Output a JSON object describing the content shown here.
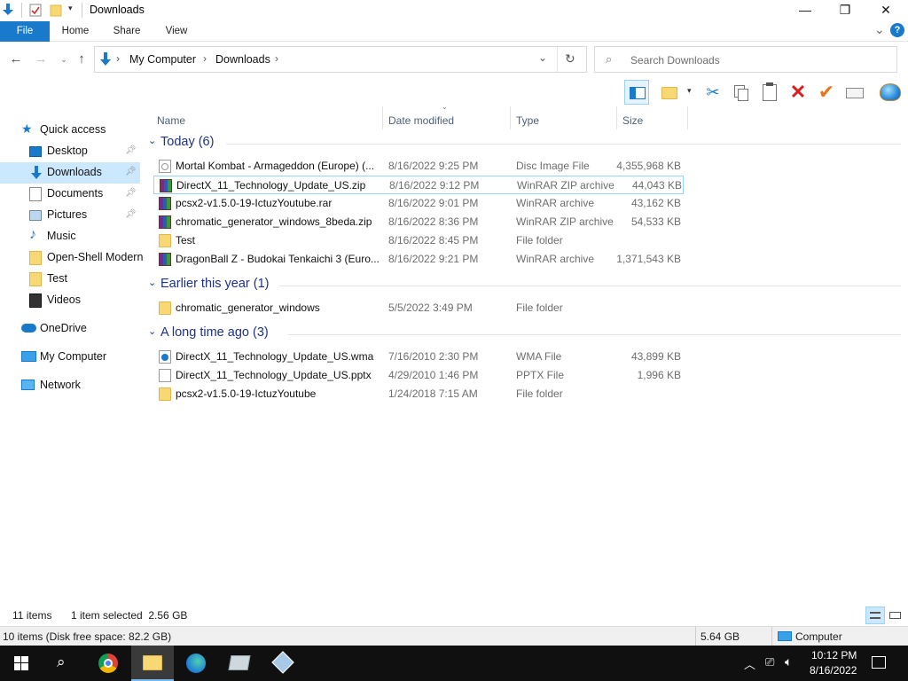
{
  "window": {
    "title": "Downloads",
    "controls": {
      "minimize": "—",
      "maximize": "❐",
      "close": "✕"
    }
  },
  "ribbon": {
    "tabs": [
      "File",
      "Home",
      "Share",
      "View"
    ],
    "help": "?",
    "expand": "⌄"
  },
  "address": {
    "crumbs": [
      "My Computer",
      "Downloads"
    ],
    "sep": "›",
    "search_placeholder": "Search Downloads"
  },
  "nav": {
    "quick_access": "Quick access",
    "pinned": [
      {
        "label": "Desktop",
        "icon": "desktop-icon",
        "pinned": true
      },
      {
        "label": "Downloads",
        "icon": "downloads-icon",
        "pinned": true,
        "selected": true
      },
      {
        "label": "Documents",
        "icon": "documents-icon",
        "pinned": true
      },
      {
        "label": "Pictures",
        "icon": "pictures-icon",
        "pinned": true
      },
      {
        "label": "Music",
        "icon": "music-icon",
        "pinned": false
      },
      {
        "label": "Open-Shell Modern",
        "icon": "folder-icon",
        "pinned": false
      },
      {
        "label": "Test",
        "icon": "folder-icon",
        "pinned": false
      },
      {
        "label": "Videos",
        "icon": "videos-icon",
        "pinned": false
      }
    ],
    "onedrive": "OneDrive",
    "my_computer": "My Computer",
    "network": "Network"
  },
  "columns": [
    "Name",
    "Date modified",
    "Type",
    "Size"
  ],
  "groups": [
    {
      "title": "Today (6)",
      "rows": [
        {
          "name": "Mortal Kombat - Armageddon (Europe) (...",
          "date": "8/16/2022 9:25 PM",
          "type": "Disc Image File",
          "size": "4,355,968 KB",
          "icon": "disc-image-icon"
        },
        {
          "name": "DirectX_11_Technology_Update_US.zip",
          "date": "8/16/2022 9:12 PM",
          "type": "WinRAR ZIP archive",
          "size": "44,043 KB",
          "icon": "winrar-icon",
          "selected": true
        },
        {
          "name": "pcsx2-v1.5.0-19-IctuzYoutube.rar",
          "date": "8/16/2022 9:01 PM",
          "type": "WinRAR archive",
          "size": "43,162 KB",
          "icon": "winrar-icon"
        },
        {
          "name": "chromatic_generator_windows_8beda.zip",
          "date": "8/16/2022 8:36 PM",
          "type": "WinRAR ZIP archive",
          "size": "54,533 KB",
          "icon": "winrar-icon"
        },
        {
          "name": "Test",
          "date": "8/16/2022 8:45 PM",
          "type": "File folder",
          "size": "",
          "icon": "folder-icon"
        },
        {
          "name": "DragonBall Z - Budokai Tenkaichi 3 (Euro...",
          "date": "8/16/2022 9:21 PM",
          "type": "WinRAR archive",
          "size": "1,371,543 KB",
          "icon": "winrar-icon"
        }
      ]
    },
    {
      "title": "Earlier this year (1)",
      "rows": [
        {
          "name": "chromatic_generator_windows",
          "date": "5/5/2022 3:49 PM",
          "type": "File folder",
          "size": "",
          "icon": "folder-icon"
        }
      ]
    },
    {
      "title": "A long time ago (3)",
      "rows": [
        {
          "name": "DirectX_11_Technology_Update_US.wma",
          "date": "7/16/2010 2:30 PM",
          "type": "WMA File",
          "size": "43,899 KB",
          "icon": "media-file-icon"
        },
        {
          "name": "DirectX_11_Technology_Update_US.pptx",
          "date": "4/29/2010 1:46 PM",
          "type": "PPTX File",
          "size": "1,996 KB",
          "icon": "file-icon"
        },
        {
          "name": "pcsx2-v1.5.0-19-IctuzYoutube",
          "date": "1/24/2018 7:15 AM",
          "type": "File folder",
          "size": "",
          "icon": "folder-icon"
        }
      ]
    }
  ],
  "status": {
    "items": "11 items",
    "selected": "1 item selected  2.56 GB",
    "disk": "10 items (Disk free space: 82.2 GB)",
    "size": "5.64 GB",
    "location": "Computer"
  },
  "taskbar": {
    "time": "10:12 PM",
    "date": "8/16/2022"
  },
  "colors": {
    "accent": "#1979ca",
    "group_title": "#1e3287",
    "selection_border": "#99d1ff",
    "nav_selected": "#cce8ff"
  }
}
